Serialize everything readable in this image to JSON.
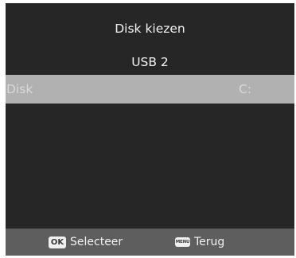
{
  "dialog": {
    "title": "Disk kiezen",
    "subtitle": "USB 2"
  },
  "disks": [
    {
      "name": "Disk",
      "drive": "C:",
      "selected": true
    }
  ],
  "footer": {
    "ok_key": "OK",
    "ok_label": "Selecteer",
    "menu_key": "MENU",
    "menu_label": "Terug"
  },
  "colors": {
    "background": "#262626",
    "selected_row": "#b1b1b1",
    "footer_bar": "#5e5e5e",
    "text": "#f2f2f2"
  }
}
